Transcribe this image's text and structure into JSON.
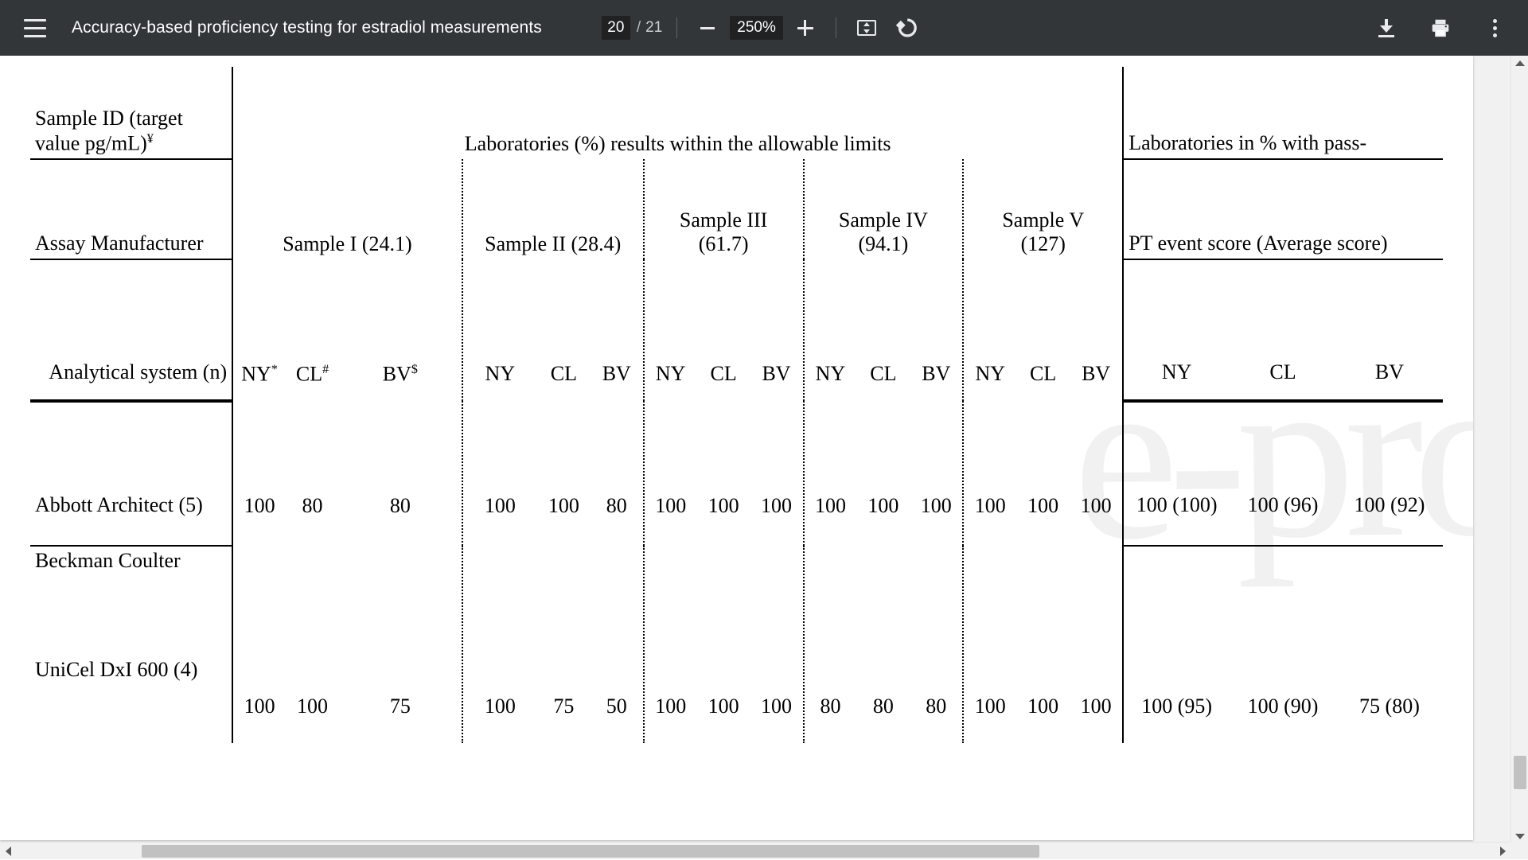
{
  "toolbar": {
    "menu_icon": "hamburger-menu-icon",
    "title": "Accuracy-based proficiency testing for estradiol measurements",
    "page_current": "20",
    "page_separator": "/",
    "page_total": "21",
    "zoom_out_icon": "minus-icon",
    "zoom_value": "250%",
    "zoom_in_icon": "plus-icon",
    "fit_icon": "fit-to-page-icon",
    "rotate_icon": "rotate-counterclockwise-icon",
    "download_icon": "download-icon",
    "print_icon": "print-icon",
    "more_icon": "more-vertical-icon"
  },
  "watermark": "e-pro",
  "table": {
    "header": {
      "corner_label": "Sample ID (target value pg/mL)",
      "corner_label_sup": "¥",
      "group_center": "Laboratories (%) results within the allowable limits",
      "group_right": "Laboratories in % with pass-",
      "row2_left": "Assay Manufacturer",
      "row2_right": "PT event score (Average score)",
      "row3_left": "Analytical system (n)",
      "samples": [
        {
          "name": "Sample I",
          "target": "(24.1)"
        },
        {
          "name": "Sample II",
          "target": "(28.4)"
        },
        {
          "name": "Sample III",
          "target": "(61.7)"
        },
        {
          "name": "Sample IV",
          "target": "(94.1)"
        },
        {
          "name": "Sample V",
          "target": "(127)"
        }
      ],
      "sub_s1": {
        "ny": "NY",
        "ny_sup": "*",
        "cl": "CL",
        "cl_sup": "#",
        "bv": "BV",
        "bv_sup": "$"
      },
      "sub": {
        "ny": "NY",
        "cl": "CL",
        "bv": "BV"
      },
      "sub_right": {
        "ny": "NY",
        "cl": "CL",
        "bv": "BV"
      }
    },
    "rows": [
      {
        "manufacturer": "",
        "system": "Abbott Architect (5)",
        "s1": {
          "ny": "100",
          "cl": "80",
          "bv": "80"
        },
        "s2": {
          "ny": "100",
          "cl": "100",
          "bv": "80"
        },
        "s3": {
          "ny": "100",
          "cl": "100",
          "bv": "100"
        },
        "s4": {
          "ny": "100",
          "cl": "100",
          "bv": "100"
        },
        "s5": {
          "ny": "100",
          "cl": "100",
          "bv": "100"
        },
        "pt": {
          "ny": "100 (100)",
          "cl": "100 (96)",
          "bv": "100 (92)"
        }
      },
      {
        "manufacturer": "Beckman Coulter",
        "system": "UniCel DxI 600 (4)",
        "s1": {
          "ny": "100",
          "cl": "100",
          "bv": "75"
        },
        "s2": {
          "ny": "100",
          "cl": "75",
          "bv": "50"
        },
        "s3": {
          "ny": "100",
          "cl": "100",
          "bv": "100"
        },
        "s4": {
          "ny": "80",
          "cl": "80",
          "bv": "80"
        },
        "s5": {
          "ny": "100",
          "cl": "100",
          "bv": "100"
        },
        "pt": {
          "ny": "100 (95)",
          "cl": "100 (90)",
          "bv": "75 (80)"
        }
      }
    ]
  }
}
